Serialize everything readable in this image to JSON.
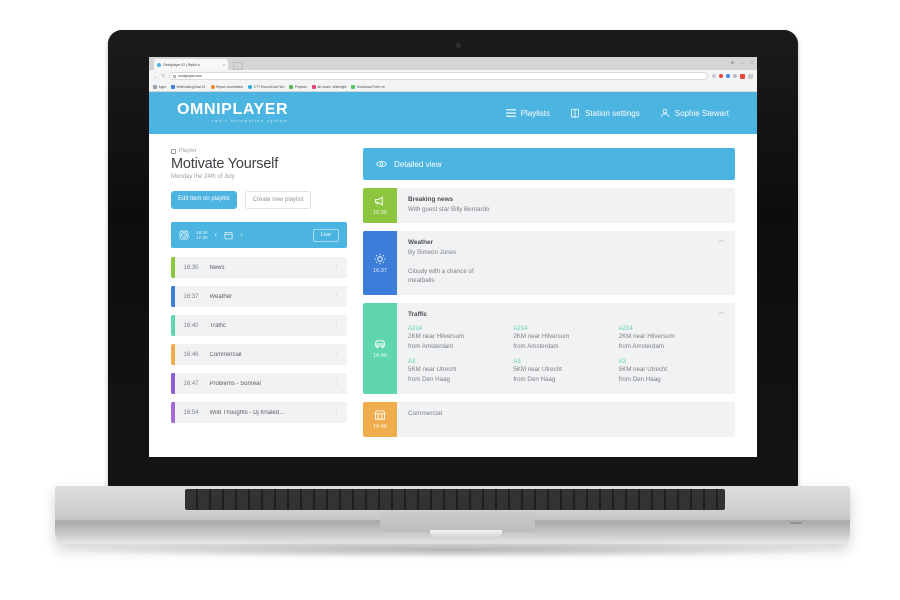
{
  "browser": {
    "tab": {
      "title": "Omniplayer 02 | Radio a",
      "close": "×"
    },
    "window_controls": {
      "minimize": "–",
      "maximize": "□",
      "restore": "⊕"
    },
    "url": "omniplayer.com",
    "nav": {
      "back": "←",
      "forward": "→",
      "reload": "↻"
    },
    "bookmarks": [
      {
        "label": "Apps",
        "color": "#9aa0a6"
      },
      {
        "label": "Webhosting/host 01",
        "color": "#3b82d6"
      },
      {
        "label": "Repair coordinator",
        "color": "#f0872b"
      },
      {
        "label": "CTT RoundCube Wo",
        "color": "#2fa8df"
      },
      {
        "label": "Projects",
        "color": "#63b55a"
      },
      {
        "label": "All music -Webnight",
        "color": "#e8447f"
      },
      {
        "label": "Download Forte on",
        "color": "#5bc16b"
      }
    ]
  },
  "app": {
    "brand": {
      "name": "OMNIPLAYER",
      "tagline": "radio automation system"
    },
    "nav": [
      {
        "label": "Playlists",
        "icon": "list-icon"
      },
      {
        "label": "Station settings",
        "icon": "building-icon"
      },
      {
        "label": "Sophie Stewart",
        "icon": "user-icon"
      }
    ],
    "accent": "#4cb4e0"
  },
  "left": {
    "breadcrumb": "Playlist",
    "title": "Motivate Yourself",
    "subtitle": "Monday the 24th of July",
    "buttons": {
      "edit": "Edit item on playlist",
      "create": "Create new playlist"
    },
    "player": {
      "time_start": "16:30",
      "time_end": "17:30",
      "prev": "‹",
      "next": "›",
      "live": "Live"
    },
    "items": [
      {
        "time": "16:30",
        "name": "News",
        "color": "#8cc63f"
      },
      {
        "time": "16:37",
        "name": "Weather",
        "color": "#3b7dd8"
      },
      {
        "time": "16:40",
        "name": "Traffic",
        "color": "#5fd6b0"
      },
      {
        "time": "16:46",
        "name": "Commercial",
        "color": "#f0ad4e"
      },
      {
        "time": "16:47",
        "name": "Problems - Sonreal",
        "color": "#8e5ed6"
      },
      {
        "time": "16:54",
        "name": "Wild Thoughts - Dj Khaled…",
        "color": "#a26bd8"
      }
    ]
  },
  "right": {
    "header": {
      "label": "Detailed view",
      "icon": "eye-icon"
    },
    "cards": [
      {
        "time": "16:30",
        "color": "#8cc63f",
        "icon": "megaphone-icon",
        "title": "Breaking news",
        "subtitle": "With guest star Billy Bernardo",
        "text": "",
        "collapsible": false
      },
      {
        "time": "16:37",
        "color": "#3b7dd8",
        "icon": "sun-icon",
        "title": "Weather",
        "subtitle": "By Simeon Jones",
        "text": "Cloudy with a chance of meatballs",
        "collapsible": true
      },
      {
        "time": "16:40",
        "color": "#5fd6b0",
        "icon": "car-icon",
        "title": "Traffic",
        "subtitle": "",
        "text": "",
        "collapsible": true,
        "traffic": {
          "row1": [
            {
              "road": "A214",
              "line1": "2KM near Hilversum",
              "line2": "from Amsterdam"
            },
            {
              "road": "A214",
              "line1": "2KM near Hilversum",
              "line2": "from Amsterdam"
            },
            {
              "road": "A214",
              "line1": "2KM near Hilversum",
              "line2": "from Amsterdam"
            }
          ],
          "row2": [
            {
              "road": "A3",
              "line1": "5KM near Utrecht",
              "line2": "from Den Haag"
            },
            {
              "road": "A3",
              "line1": "5KM near Utrecht",
              "line2": "from Den Haag"
            },
            {
              "road": "A3",
              "line1": "5KM near Utrecht",
              "line2": "from Den Haag"
            }
          ]
        }
      },
      {
        "time": "16:46",
        "color": "#f0ad4e",
        "icon": "shop-icon",
        "title": "Commercial",
        "subtitle": "",
        "text": "",
        "collapsible": false
      }
    ]
  }
}
